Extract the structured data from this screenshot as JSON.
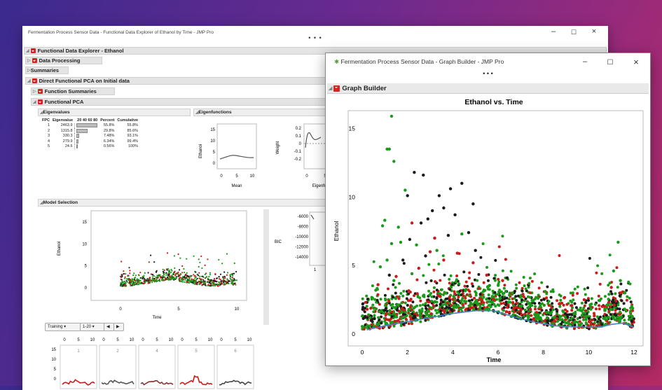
{
  "main_window": {
    "title": "Fermentation Process Sensor Data - Functional Data Explorer of Ethanol by Time - JMP Pro",
    "menu_dots": "• • •",
    "fde_header": "Functional Data Explorer - Ethanol",
    "data_processing": "Data Processing",
    "summaries": "Summaries",
    "direct_fpca": "Direct Functional PCA on Initial data",
    "function_summaries": "Function Summaries",
    "functional_pca": "Functional PCA",
    "eigenvalues": {
      "title": "Eigenvalues",
      "headers": [
        "FPC",
        "Eigenvalue",
        "20 40 60 80",
        "Percent",
        "Cumulative"
      ],
      "rows": [
        {
          "fpc": "1",
          "eigenvalue": "2463.9",
          "percent": "55.8%",
          "cumulative": "55.8%",
          "pct": 55.8
        },
        {
          "fpc": "2",
          "eigenvalue": "1315.8",
          "percent": "29.8%",
          "cumulative": "85.6%",
          "pct": 29.8
        },
        {
          "fpc": "3",
          "eigenvalue": "330.3",
          "percent": "7.48%",
          "cumulative": "93.1%",
          "pct": 7.48
        },
        {
          "fpc": "4",
          "eigenvalue": "279.9",
          "percent": "6.34%",
          "cumulative": "99.4%",
          "pct": 6.34
        },
        {
          "fpc": "5",
          "eigenvalue": "24.6",
          "percent": "0.56%",
          "cumulative": "100%",
          "pct": 0.56
        }
      ]
    },
    "eigenfunctions": {
      "title": "Eigenfunctions",
      "mean_ylabel": "Ethanol",
      "mean_yticks": [
        "15",
        "10",
        "5",
        "0"
      ],
      "mean_xticks": [
        "0",
        "5",
        "10"
      ],
      "mean_xlabel": "Mean",
      "eig_ylabel": "Weight",
      "eig_yticks": [
        "0.2",
        "0.1",
        "0",
        "-0.1",
        "-0.2"
      ],
      "eig_xticks": [
        "0",
        "5"
      ],
      "eig_xlabel": "Eigenfu"
    },
    "model_selection": {
      "title": "Model Selection",
      "ylabel": "Ethanol",
      "yticks": [
        "15",
        "10",
        "5",
        "0"
      ],
      "xticks": [
        "0",
        "5",
        "10"
      ],
      "xlabel": "Time",
      "bic_label": "BIC",
      "bic_ticks": [
        "-6000",
        "-8000",
        "-10000",
        "-12000",
        "-14000"
      ],
      "bic_xtick": "1"
    },
    "controls": {
      "training": "Training",
      "range": "1-20",
      "prev": "◀",
      "next": "▶"
    },
    "thumbs": {
      "xticks": [
        "0",
        "5",
        "10"
      ],
      "yticks": [
        "15",
        "10",
        "5",
        "0"
      ],
      "labels": [
        "1",
        "2",
        "4",
        "5",
        "6"
      ]
    }
  },
  "graph_builder_window": {
    "title": "Fermentation Process Sensor Data - Graph Builder - JMP Pro",
    "menu_dots": "• • •",
    "header": "Graph Builder"
  },
  "chart_data": {
    "type": "scatter",
    "title": "Ethanol vs. Time",
    "xlabel": "Time",
    "ylabel": "Ethanol",
    "xlim": [
      0,
      12
    ],
    "ylim": [
      0,
      16
    ],
    "xticks": [
      "0",
      "2",
      "4",
      "6",
      "8",
      "10",
      "12"
    ],
    "yticks": [
      "0",
      "5",
      "10",
      "15"
    ],
    "series": [
      {
        "color": "#1a9a1a",
        "points": [
          [
            1.3,
            15.9
          ],
          [
            1.1,
            13.5
          ],
          [
            1.2,
            13.5
          ],
          [
            1.4,
            12.6
          ],
          [
            1.9,
            10.5
          ],
          [
            1.0,
            8.3
          ],
          [
            0.9,
            7.9
          ],
          [
            1.7,
            6.7
          ],
          [
            1.3,
            6.6
          ],
          [
            1.6,
            7.8
          ],
          [
            2.4,
            6.5
          ],
          [
            1.1,
            5.4
          ],
          [
            0.8,
            4.9
          ],
          [
            1.4,
            3.9
          ],
          [
            11.3,
            6.7
          ],
          [
            11.1,
            4.6
          ],
          [
            11.4,
            3.9
          ],
          [
            11.6,
            3.0
          ],
          [
            3.3,
            6.1
          ],
          [
            4.4,
            7.3
          ],
          [
            0.6,
            3.2
          ],
          [
            2.2,
            4.4
          ],
          [
            5.6,
            3.5
          ],
          [
            6.1,
            2.6
          ],
          [
            10.9,
            2.9
          ]
        ]
      },
      {
        "color": "#1b1b1b",
        "points": [
          [
            2.3,
            11.8
          ],
          [
            2.7,
            11.6
          ],
          [
            2.0,
            10.1
          ],
          [
            4.4,
            11.0
          ],
          [
            3.9,
            10.6
          ],
          [
            3.6,
            9.2
          ],
          [
            2.9,
            8.4
          ],
          [
            3.4,
            10.1
          ],
          [
            4.9,
            9.5
          ],
          [
            3.1,
            9.0
          ],
          [
            2.6,
            8.1
          ],
          [
            4.1,
            8.7
          ],
          [
            1.8,
            5.4
          ],
          [
            2.1,
            6.9
          ],
          [
            3.8,
            7.2
          ],
          [
            5.0,
            6.1
          ],
          [
            4.7,
            7.4
          ],
          [
            2.8,
            5.7
          ],
          [
            6.4,
            4.1
          ],
          [
            1.2,
            4.3
          ]
        ]
      },
      {
        "color": "#cc1a1a",
        "points": [
          [
            2.2,
            8.1
          ],
          [
            3.2,
            7.0
          ],
          [
            3.0,
            6.0
          ],
          [
            4.2,
            5.9
          ],
          [
            4.9,
            5.2
          ],
          [
            5.5,
            4.3
          ],
          [
            6.2,
            3.9
          ],
          [
            1.5,
            4.2
          ],
          [
            2.5,
            4.8
          ],
          [
            3.6,
            5.4
          ],
          [
            11.4,
            3.0
          ],
          [
            11.0,
            3.4
          ],
          [
            8.7,
            2.2
          ],
          [
            9.8,
            2.5
          ],
          [
            7.1,
            2.9
          ],
          [
            0.7,
            3.6
          ]
        ]
      }
    ],
    "mean_curve": [
      [
        0.2,
        0.3
      ],
      [
        1,
        0.6
      ],
      [
        2,
        0.9
      ],
      [
        3,
        1.2
      ],
      [
        4,
        1.5
      ],
      [
        5,
        1.7
      ],
      [
        5.8,
        1.7
      ],
      [
        6.6,
        1.3
      ],
      [
        7.5,
        0.9
      ],
      [
        8.5,
        0.6
      ],
      [
        9.5,
        0.5
      ],
      [
        10.5,
        0.5
      ],
      [
        11,
        0.7
      ],
      [
        11.5,
        0.8
      ],
      [
        12,
        0.5
      ]
    ]
  },
  "colors": {
    "green": "#1a9a1a",
    "black": "#1b1b1b",
    "red": "#cc1a1a",
    "mean_curve": "#4a7fc8",
    "red_triangle": "#d62424"
  }
}
